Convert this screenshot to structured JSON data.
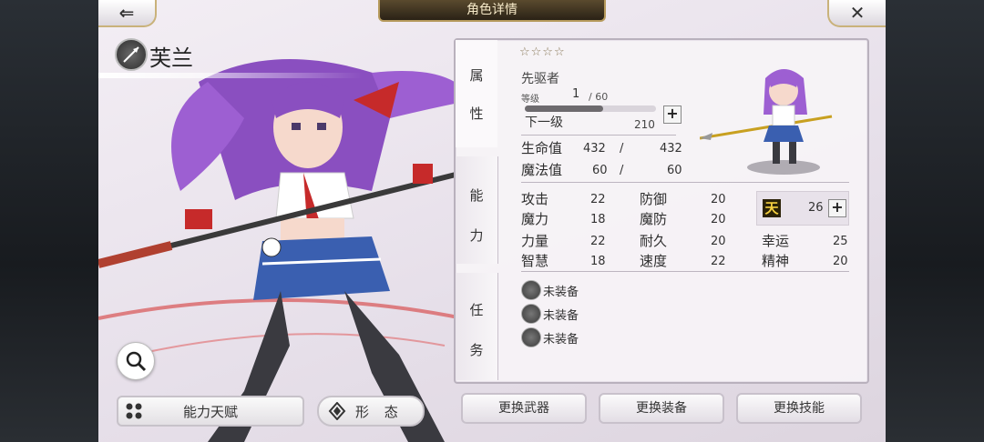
{
  "header": {
    "title": "角色详情",
    "back_icon": "arrow-left-icon",
    "close_icon": "close-icon"
  },
  "character": {
    "name": "芙兰",
    "class_icon": "spear-class-icon"
  },
  "buttons": {
    "talent": "能力天赋",
    "form": "形 态",
    "change_weapon": "更换武器",
    "change_equipment": "更换装备",
    "change_skill": "更换技能"
  },
  "tabs": {
    "attributes": [
      "属",
      "性"
    ],
    "abilities": [
      "能",
      "力"
    ],
    "missions": [
      "任",
      "务"
    ]
  },
  "profile": {
    "stars": "☆☆☆☆",
    "class_name": "先驱者",
    "level_label": "等级",
    "level": "1",
    "level_max": "/ 60",
    "next_label": "下一级",
    "next_exp": "210",
    "exp_progress": 0.6
  },
  "vitals": [
    {
      "label": "生命值",
      "current": "432",
      "sep": "/",
      "max": "432"
    },
    {
      "label": "魔法值",
      "current": "60",
      "sep": "/",
      "max": "60"
    }
  ],
  "stats_left": [
    {
      "label": "攻击",
      "value": "22"
    },
    {
      "label": "魔力",
      "value": "18"
    },
    {
      "label": "力量",
      "value": "22"
    },
    {
      "label": "智慧",
      "value": "18"
    }
  ],
  "stats_mid": [
    {
      "label": "防御",
      "value": "20"
    },
    {
      "label": "魔防",
      "value": "20"
    },
    {
      "label": "耐久",
      "value": "20"
    },
    {
      "label": "速度",
      "value": "22"
    }
  ],
  "stats_right": [
    {
      "label": "幸运",
      "value": "25"
    },
    {
      "label": "精神",
      "value": "20"
    }
  ],
  "heaven": {
    "char": "天",
    "value": "26"
  },
  "equipment": [
    {
      "icon": "spear-icon",
      "label": "未装备"
    },
    {
      "icon": "armor-icon",
      "label": "未装备"
    },
    {
      "icon": "accessory-icon",
      "label": "未装备"
    }
  ]
}
